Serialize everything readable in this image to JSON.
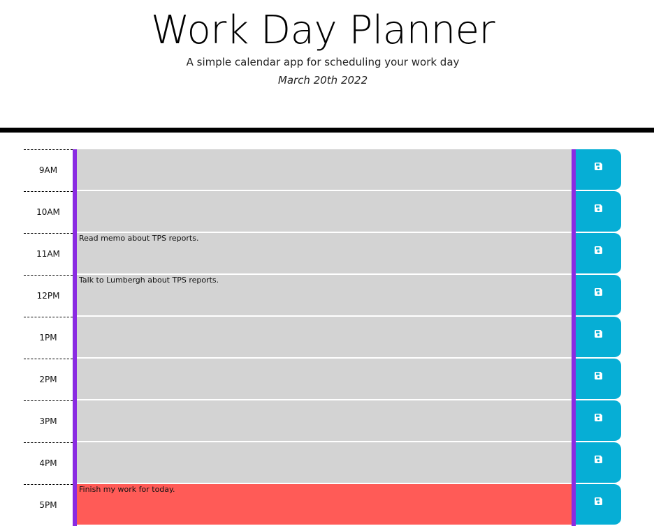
{
  "header": {
    "title": "Work Day Planner",
    "subtitle": "A simple calendar app for scheduling your work day",
    "date": "March 20th 2022"
  },
  "colors": {
    "past": "#d3d3d3",
    "present": "#ff5b57",
    "accent_bar": "#8a2be2",
    "save_button": "#06aed5"
  },
  "rows": [
    {
      "hour": "9AM",
      "text": "",
      "state": "past",
      "icon": "save-icon"
    },
    {
      "hour": "10AM",
      "text": "",
      "state": "past",
      "icon": "save-icon"
    },
    {
      "hour": "11AM",
      "text": "Read memo about TPS reports.",
      "state": "past",
      "icon": "save-icon"
    },
    {
      "hour": "12PM",
      "text": "Talk to Lumbergh about TPS reports.",
      "state": "past",
      "icon": "save-icon"
    },
    {
      "hour": "1PM",
      "text": "",
      "state": "past",
      "icon": "save-icon"
    },
    {
      "hour": "2PM",
      "text": "",
      "state": "past",
      "icon": "save-icon"
    },
    {
      "hour": "3PM",
      "text": "",
      "state": "past",
      "icon": "save-icon"
    },
    {
      "hour": "4PM",
      "text": "",
      "state": "past",
      "icon": "save-icon"
    },
    {
      "hour": "5PM",
      "text": "Finish my work for today.",
      "state": "present",
      "icon": "save-icon"
    }
  ]
}
